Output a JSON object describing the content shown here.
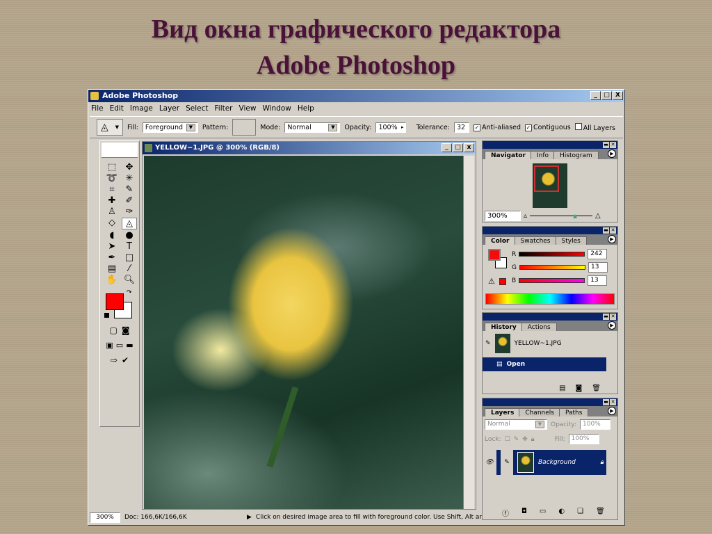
{
  "slide": {
    "title_line1": "Вид окна графического редактора",
    "title_line2": "Adobe Photoshop"
  },
  "app": {
    "title": "Adobe Photoshop",
    "controls": [
      "_",
      "□",
      "X"
    ]
  },
  "menu": [
    "File",
    "Edit",
    "Image",
    "Layer",
    "Select",
    "Filter",
    "View",
    "Window",
    "Help"
  ],
  "options": {
    "fill_label": "Fill:",
    "fill_value": "Foreground",
    "pattern_label": "Pattern:",
    "mode_label": "Mode:",
    "mode_value": "Normal",
    "opacity_label": "Opacity:",
    "opacity_value": "100%",
    "tolerance_label": "Tolerance:",
    "tolerance_value": "32",
    "anti_aliased": "Anti-aliased",
    "contiguous": "Contiguous",
    "all_layers": "All Layers",
    "anti_aliased_checked": true,
    "contiguous_checked": true,
    "all_layers_checked": false
  },
  "document": {
    "title": "YELLOW~1.JPG @ 300% (RGB/8)"
  },
  "status": {
    "zoom": "300%",
    "doc": "Doc: 166,6K/166,6K",
    "hint": "Click on desired image area to fill with foreground color.  Use Shift, Alt and C"
  },
  "navigator": {
    "tabs": [
      "Navigator",
      "Info",
      "Histogram"
    ],
    "zoom": "300%"
  },
  "color": {
    "tabs": [
      "Color",
      "Swatches",
      "Styles"
    ],
    "r_label": "R",
    "g_label": "G",
    "b_label": "B",
    "r": "242",
    "g": "13",
    "b": "13",
    "foreground": "#f20d0d"
  },
  "history": {
    "tabs": [
      "History",
      "Actions"
    ],
    "snapshot": "YELLOW~1.JPG",
    "step": "Open"
  },
  "layers": {
    "tabs": [
      "Layers",
      "Channels",
      "Paths"
    ],
    "blend": "Normal",
    "opacity_label": "Opacity:",
    "opacity": "100%",
    "lock_label": "Lock:",
    "fill_label": "Fill:",
    "fill": "100%",
    "layer_name": "Background"
  }
}
